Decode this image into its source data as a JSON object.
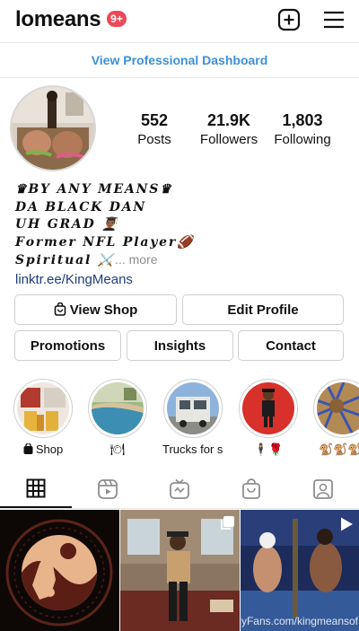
{
  "header": {
    "username": "lomeans",
    "notification_count": "9+",
    "new_post_icon": "plus-square-icon",
    "menu_icon": "hamburger-menu-icon"
  },
  "professional_dashboard": {
    "label": "View Professional Dashboard",
    "color": "#3d8fd8"
  },
  "profile": {
    "stats": [
      {
        "value": "552",
        "label": "Posts"
      },
      {
        "value": "21.9K",
        "label": "Followers"
      },
      {
        "value": "1,803",
        "label": "Following"
      }
    ],
    "bio_lines": [
      "♛𝑩𝒀 𝑨𝑵𝒀 𝑴𝑬𝑨𝑵𝑺♛",
      "𝑫𝑨 𝑩𝑳𝑨𝑪𝑲 𝑫𝑨𝑵",
      "𝑼𝑯 𝑮𝑹𝑨𝑫 👨🏾‍🎓",
      "𝑭𝒐𝒓𝒎𝒆𝒓 𝑵𝑭𝑳 𝑷𝒍𝒂𝒚𝒆𝒓🏈",
      "𝑺𝒑𝒊𝒓𝒊𝒕𝒖𝒂𝒍 ⚔️"
    ],
    "bio_more": "... more",
    "link": "linktr.ee/KingMeans"
  },
  "buttons": {
    "view_shop": "View Shop",
    "edit_profile": "Edit Profile",
    "promotions": "Promotions",
    "insights": "Insights",
    "contact": "Contact"
  },
  "highlights": [
    {
      "caption": "Shop",
      "icon": "shopping-bag-icon"
    },
    {
      "caption": "🍽"
    },
    {
      "caption": "Trucks for s..."
    },
    {
      "caption": "🕴🌹"
    },
    {
      "caption": "🐒🐒🐒"
    }
  ],
  "tabs": [
    {
      "icon": "grid-icon",
      "active": true
    },
    {
      "icon": "reels-icon"
    },
    {
      "icon": "igtv-icon"
    },
    {
      "icon": "shop-bag-icon"
    },
    {
      "icon": "tagged-icon"
    }
  ],
  "grid": {
    "watermark": "OnlyFans.com/kingmeansof",
    "cell_icons": [
      "",
      "carousel-icon",
      "reel-play-icon"
    ]
  }
}
